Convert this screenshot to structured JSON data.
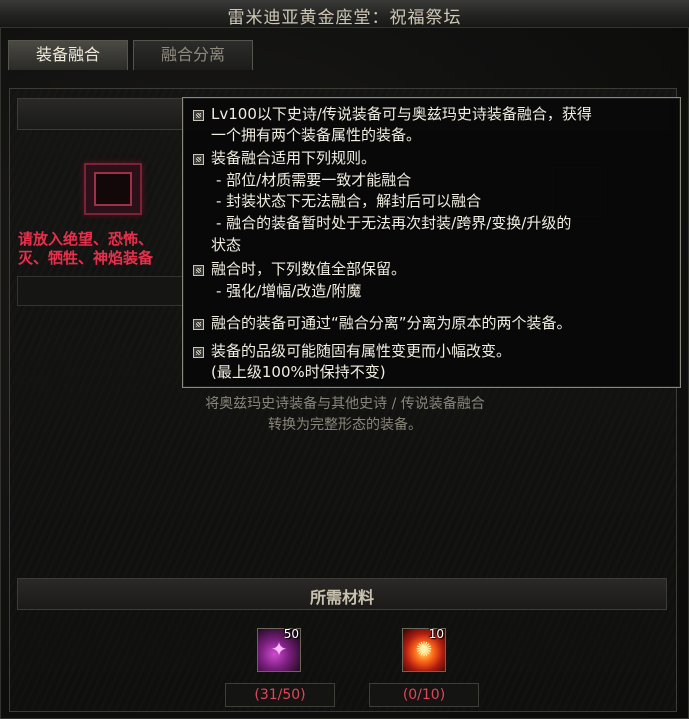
{
  "window": {
    "title": "雷米迪亚黄金座堂：祝福祭坛"
  },
  "tabs": [
    {
      "label": "装备融合",
      "active": true
    },
    {
      "label": "融合分离",
      "active": false
    }
  ],
  "slot": {
    "hint": "请放入绝望、恐怖、\n灭、牺牲、神焰装备"
  },
  "description": "将奥兹玛史诗装备与其他史诗 / 传说装备融合\n转换为完整形态的装备。",
  "materials": {
    "header": "所需材料",
    "items": [
      {
        "icon": "purple-crystal-icon",
        "badge": "50",
        "quantity": "(31/50)"
      },
      {
        "icon": "fire-orb-icon",
        "badge": "10",
        "quantity": "(0/10)"
      }
    ]
  },
  "tooltip": {
    "lines": [
      {
        "text": "Lv100以下史诗/传说装备可与奥兹玛史诗装备融合，获得",
        "bullet": true
      },
      {
        "text": "一个拥有两个装备属性的装备。",
        "bullet": false
      },
      {
        "text": "装备融合适用下列规则。",
        "bullet": true
      },
      {
        "text": "- 部位/材质需要一致才能融合",
        "bullet": false
      },
      {
        "text": "- 封装状态下无法融合，解封后可以融合",
        "bullet": false
      },
      {
        "text": "- 融合的装备暂时处于无法再次封装/跨界/变换/升级的",
        "bullet": false
      },
      {
        "text": "状态",
        "bullet": false
      },
      {
        "text": "融合时，下列数值全部保留。",
        "bullet": true
      },
      {
        "text": "- 强化/增幅/改造/附魔",
        "bullet": false
      },
      {
        "text": "融合的装备可通过“融合分离”分离为原本的两个装备。",
        "bullet": true
      },
      {
        "text": "装备的品级可能随固有属性变更而小幅改变。",
        "bullet": true
      },
      {
        "text": "(最上级100%时保持不变)",
        "bullet": false
      }
    ]
  },
  "colors": {
    "hint_red": "#e8304c",
    "quantity_red": "#e0465a",
    "tooltip_border": "#8a877c"
  }
}
